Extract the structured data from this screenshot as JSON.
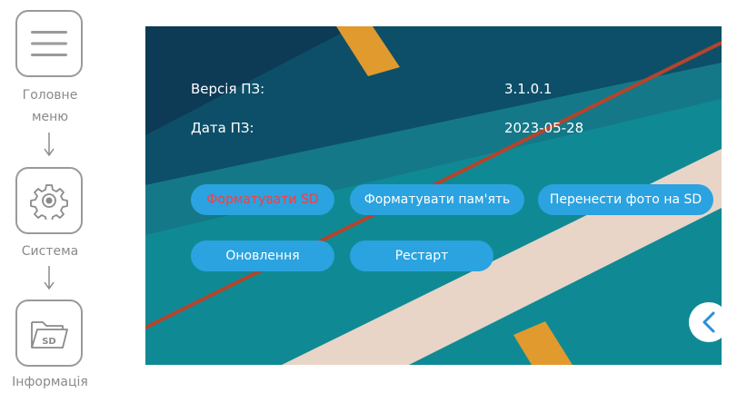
{
  "nav": {
    "items": [
      {
        "label": "Головне меню",
        "icon": "menu-icon"
      },
      {
        "label": "Система",
        "icon": "gear-icon"
      },
      {
        "label": "Інформація",
        "icon": "sd-folder-icon"
      }
    ],
    "sd_text": "SD"
  },
  "info": {
    "version_label": "Версія ПЗ:",
    "version_value": "3.1.0.1",
    "date_label": "Дата ПЗ:",
    "date_value": "2023-05-28"
  },
  "actions": {
    "format_sd": "Форматувати SD",
    "format_memory": "Форматувати пам'ять",
    "move_photos": "Перенести фото на SD",
    "update": "Оновлення",
    "restart": "Рестарт"
  },
  "colors": {
    "button_bg": "#2aa3e0",
    "danger_text": "#ff3b3b",
    "screen_bg": "#0f7f88",
    "back_icon": "#2a8fd8"
  }
}
